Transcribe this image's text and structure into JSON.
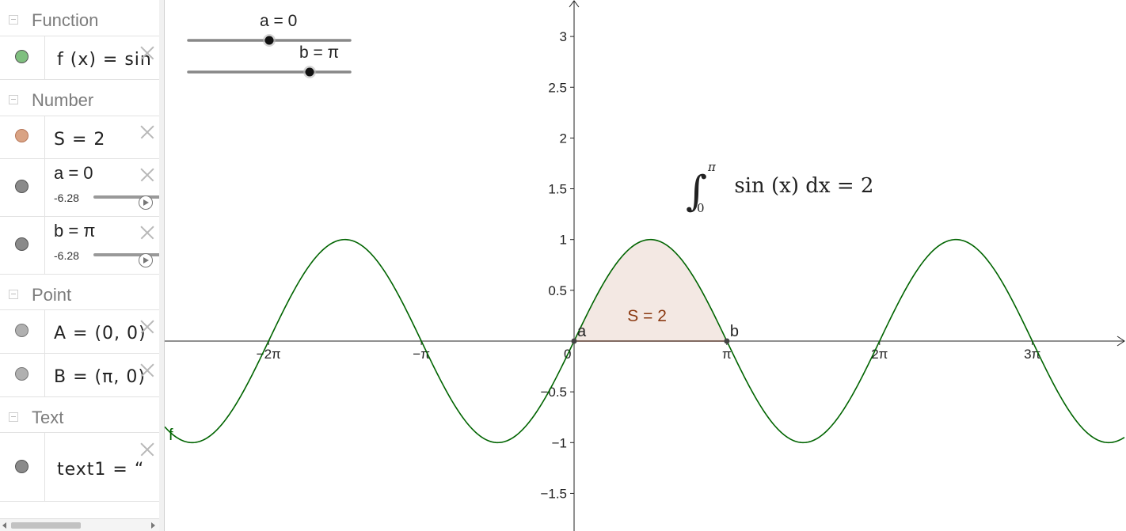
{
  "algebra": {
    "groups": {
      "function": "Function",
      "number": "Number",
      "point": "Point",
      "text": "Text"
    },
    "items": {
      "f": {
        "expr": "f (x)  =  sin (",
        "color": "#7fbf7f"
      },
      "S": {
        "expr": "S  =  2",
        "color": "#d9a384"
      },
      "a": {
        "expr": "a = 0",
        "min": "-6.28",
        "color": "#8a8a8a"
      },
      "b": {
        "expr": "b = π",
        "min": "-6.28",
        "color": "#8a8a8a"
      },
      "A": {
        "expr": "A  =  (0,  0)",
        "color": "#b0b0b0"
      },
      "B": {
        "expr": "B  =  (π,  0)",
        "color": "#b0b0b0"
      },
      "text1": {
        "expr": "text1  =   “",
        "color": "#8a8a8a"
      }
    }
  },
  "graphics": {
    "sliders": [
      {
        "label": "a = 0",
        "value": 0,
        "min": -6.28,
        "max": 6.28
      },
      {
        "label": "b = π",
        "value": 3.1416,
        "min": -6.28,
        "max": 6.28
      }
    ],
    "area_label": "S = 2",
    "point_labels": {
      "a": "a",
      "b": "b"
    },
    "function_label": "f",
    "integral": {
      "lower": "0",
      "upper": "π",
      "body": "sin (x) dx = 2"
    },
    "x_ticks": [
      "−2π",
      "−π",
      "0",
      "π",
      "2π",
      "3π"
    ],
    "y_ticks": [
      "3",
      "2.5",
      "2",
      "1.5",
      "1",
      "0.5",
      "−0.5",
      "−1",
      "−1.5"
    ],
    "colors": {
      "curve": "#006400",
      "area": "#f3e8e3",
      "area_edge": "#c8734e",
      "area_label": "#8b3a12"
    }
  },
  "chart_data": {
    "type": "line",
    "title": "",
    "series": [
      {
        "name": "f",
        "function": "sin(x)"
      }
    ],
    "xlim": [
      -8.3,
      11.3
    ],
    "ylim": [
      -1.85,
      3.3
    ],
    "x_ticks": [
      -6.2832,
      -3.1416,
      0,
      3.1416,
      6.2832,
      9.4248
    ],
    "y_ticks": [
      -1.5,
      -1,
      -0.5,
      0.5,
      1,
      1.5,
      2,
      2.5,
      3
    ],
    "shaded_area": {
      "from": 0,
      "to": 3.1416,
      "value": 2
    },
    "grid": false
  }
}
